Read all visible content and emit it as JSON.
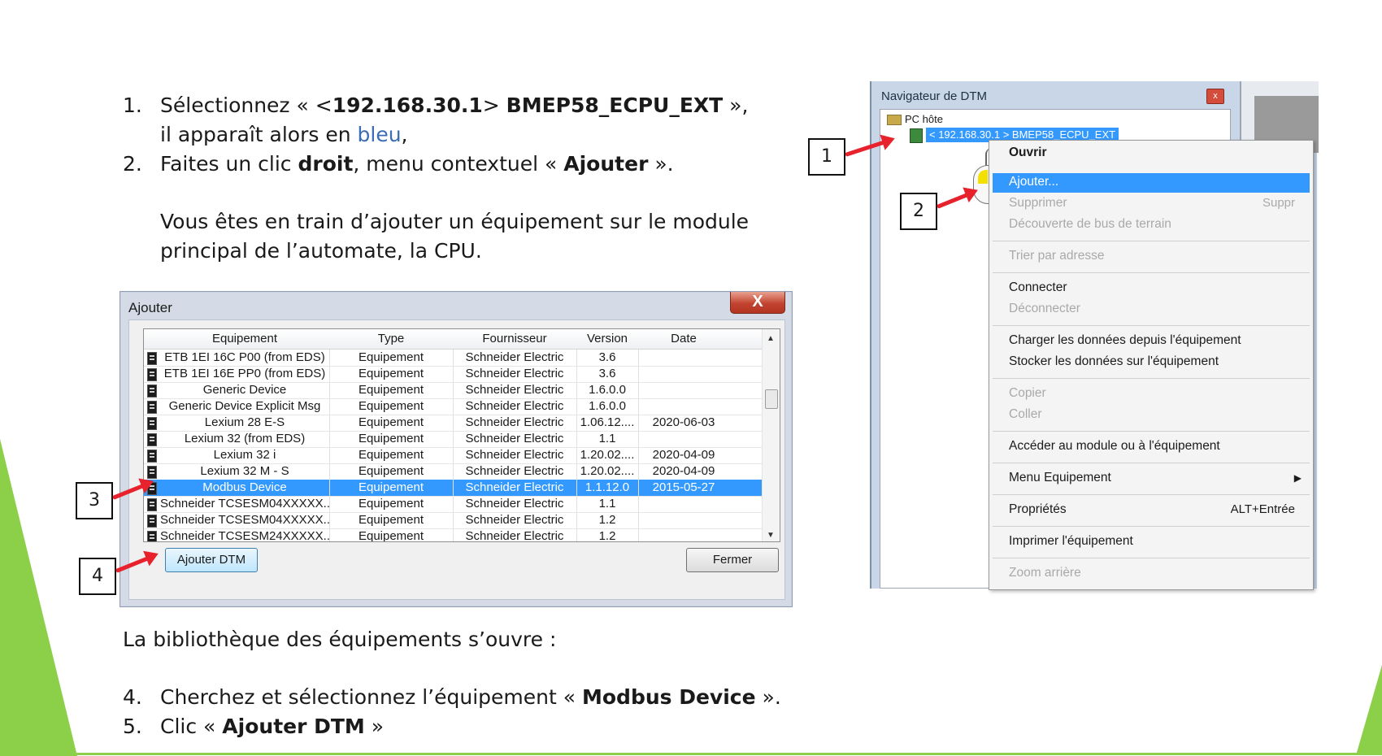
{
  "instructions": {
    "step1": {
      "num": "1.",
      "pre": "Sélectionnez « <",
      "ip": "192.168.30.1",
      "mid": "> ",
      "device": "BMEP58_ECPU_EXT",
      "post": " »,"
    },
    "step1b": {
      "pre": "il apparaît alors en ",
      "blue": "bleu",
      "post": ","
    },
    "step2": {
      "num": "2.",
      "pre": "Faites un clic ",
      "bold1": "droit",
      "mid": ", menu contextuel « ",
      "bold2": "Ajouter",
      "post": " »."
    },
    "para1": "Vous êtes en train d’ajouter un équipement sur le module",
    "para2": "principal de l’automate, la CPU.",
    "library": "La bibliothèque des équipements s’ouvre :",
    "step4": {
      "num": "4.",
      "pre": "Cherchez et sélectionnez l’équipement « ",
      "bold": "Modbus Device",
      "post": " »."
    },
    "step5": {
      "num": "5.",
      "pre": "Clic « ",
      "bold": "Ajouter DTM",
      "post": " »"
    }
  },
  "dialog": {
    "title": "Ajouter",
    "close": "X",
    "columns": [
      "Equipement",
      "Type",
      "Fournisseur",
      "Version",
      "Date"
    ],
    "rows": [
      [
        "ETB 1EI 16C P00 (from EDS)",
        "Equipement",
        "Schneider Electric",
        "3.6",
        ""
      ],
      [
        "ETB 1EI 16E PP0 (from EDS)",
        "Equipement",
        "Schneider Electric",
        "3.6",
        ""
      ],
      [
        "Generic Device",
        "Equipement",
        "Schneider Electric",
        "1.6.0.0",
        ""
      ],
      [
        "Generic Device Explicit Msg",
        "Equipement",
        "Schneider Electric",
        "1.6.0.0",
        ""
      ],
      [
        "Lexium 28 E-S",
        "Equipement",
        "Schneider Electric",
        "1.06.12....",
        "2020-06-03"
      ],
      [
        "Lexium 32 (from EDS)",
        "Equipement",
        "Schneider Electric",
        "1.1",
        ""
      ],
      [
        "Lexium 32 i",
        "Equipement",
        "Schneider Electric",
        "1.20.02....",
        "2020-04-09"
      ],
      [
        "Lexium 32 M - S",
        "Equipement",
        "Schneider Electric",
        "1.20.02....",
        "2020-04-09"
      ],
      [
        "Modbus Device",
        "Equipement",
        "Schneider Electric",
        "1.1.12.0",
        "2015-05-27"
      ],
      [
        "Schneider TCSESM04XXXXX...",
        "Equipement",
        "Schneider Electric",
        "1.1",
        ""
      ],
      [
        "Schneider TCSESM04XXXXX...",
        "Equipement",
        "Schneider Electric",
        "1.2",
        ""
      ],
      [
        "Schneider TCSESM24XXXXX...",
        "Equipement",
        "Schneider Electric",
        "1.2",
        ""
      ]
    ],
    "selected_row": 8,
    "add_button": "Ajouter DTM",
    "close_button": "Fermer"
  },
  "callouts": [
    "1",
    "2",
    "3",
    "4"
  ],
  "navigator": {
    "title": "Navigateur de DTM",
    "close": "x",
    "pc": "PC hôte",
    "cpu": "< 192.168.30.1 > BMEP58_ECPU_EXT"
  },
  "context_menu": {
    "open": "Ouvrir",
    "add": "Ajouter...",
    "delete": "Supprimer",
    "delete_shortcut": "Suppr",
    "discover": "Découverte de bus de terrain",
    "sort": "Trier par adresse",
    "connect": "Connecter",
    "disconnect": "Déconnecter",
    "load": "Charger les données depuis l'équipement",
    "store": "Stocker les données sur l'équipement",
    "copy": "Copier",
    "paste": "Coller",
    "access": "Accéder au module ou à l'équipement",
    "device_menu": "Menu Equipement",
    "properties": "Propriétés",
    "properties_shortcut": "ALT+Entrée",
    "print": "Imprimer l'équipement",
    "zoom": "Zoom arrière"
  },
  "colors": {
    "accent_green": "#8cd04a",
    "selection_blue": "#3399ff",
    "arrow_red": "#e8222c",
    "text_blue": "#3b6db4"
  }
}
